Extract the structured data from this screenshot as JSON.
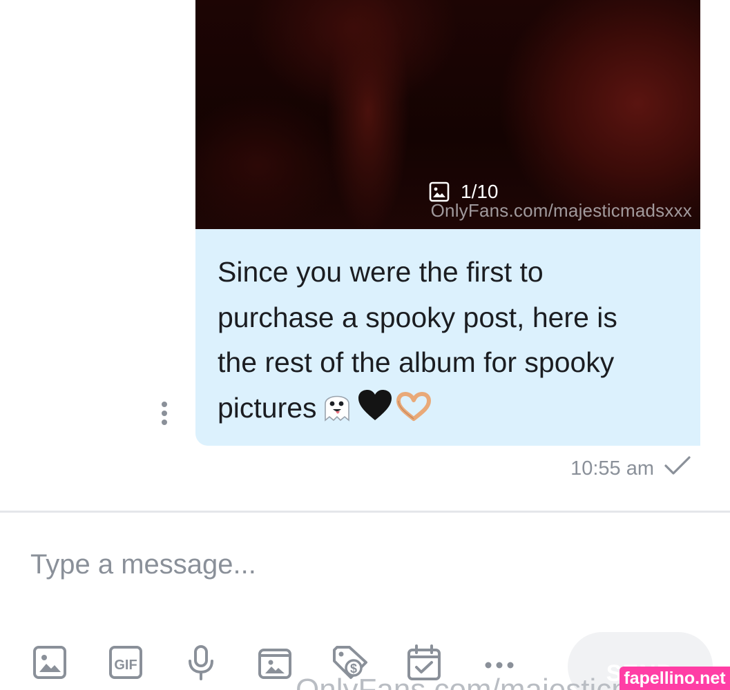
{
  "media": {
    "counter_text": "1/10",
    "watermark": "OnlyFans.com/majesticmadsxxx",
    "gallery_icon": "image-icon"
  },
  "message": {
    "text": "Since you were the first to\npurchase a spooky post, here is\nthe rest of the album for spooky\npictures",
    "emojis": [
      "ghost-emoji",
      "black-heart-emoji",
      "heart-hands-emoji"
    ],
    "time": "10:55 am",
    "status_icon": "checkmark-icon",
    "bubble_color": "#dcf1fd"
  },
  "composer": {
    "placeholder": "Type a message...",
    "value": "",
    "send_label": "SEND",
    "toolbar": [
      "image-icon",
      "gif-icon",
      "microphone-icon",
      "vault-icon",
      "price-tag-icon",
      "calendar-icon",
      "more-icon"
    ]
  },
  "watermarks": {
    "bottom": "OnlyFans.com/majesticm",
    "site": "fapellino.net"
  },
  "colors": {
    "icon_gray": "#8a9099",
    "divider": "#e4e6ea",
    "site_badge": "#ff3ea5"
  }
}
